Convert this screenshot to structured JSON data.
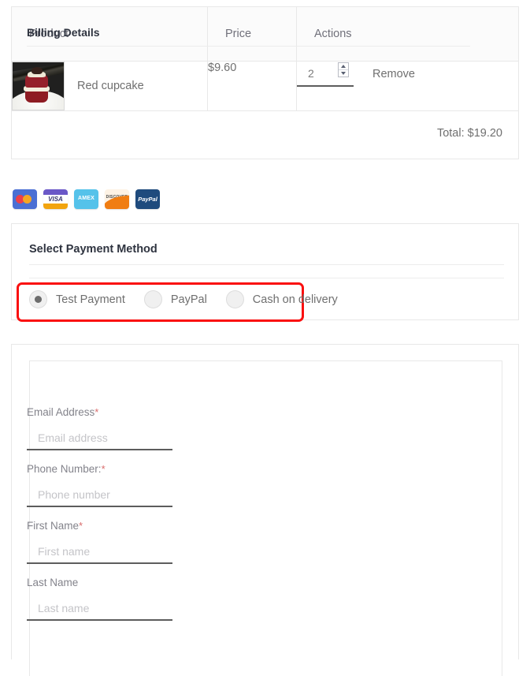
{
  "cart": {
    "columns": [
      "Product",
      "Price",
      "Actions"
    ],
    "rows": [
      {
        "product_name": "Red cupcake",
        "product_image_alt": "red-velvet-cupcake-photo",
        "price": "$9.60",
        "quantity": "2",
        "remove_label": "Remove"
      }
    ],
    "total_label": "Total: $19.20"
  },
  "payment_brands": [
    {
      "name": "mastercard",
      "label": ""
    },
    {
      "name": "visa",
      "label": "VISA"
    },
    {
      "name": "amex",
      "label": "AMEX"
    },
    {
      "name": "discover",
      "label": "DISCOVER"
    },
    {
      "name": "paypal",
      "label": "PayPal"
    }
  ],
  "payment": {
    "title": "Select Payment Method",
    "options": [
      {
        "label": "Test Payment",
        "selected": true
      },
      {
        "label": "PayPal",
        "selected": false
      },
      {
        "label": "Cash on delivery",
        "selected": false
      }
    ],
    "highlight_color": "#fa1010"
  },
  "billing": {
    "title": "Billing Details",
    "fields": [
      {
        "label": "Email Address",
        "required": true,
        "placeholder": "Email address",
        "value": ""
      },
      {
        "label": "Phone Number:",
        "required": true,
        "placeholder": "Phone number",
        "value": ""
      },
      {
        "label": "First Name",
        "required": true,
        "placeholder": "First name",
        "value": ""
      },
      {
        "label": "Last Name",
        "required": false,
        "placeholder": "Last name",
        "value": ""
      }
    ],
    "required_marker": "*"
  }
}
